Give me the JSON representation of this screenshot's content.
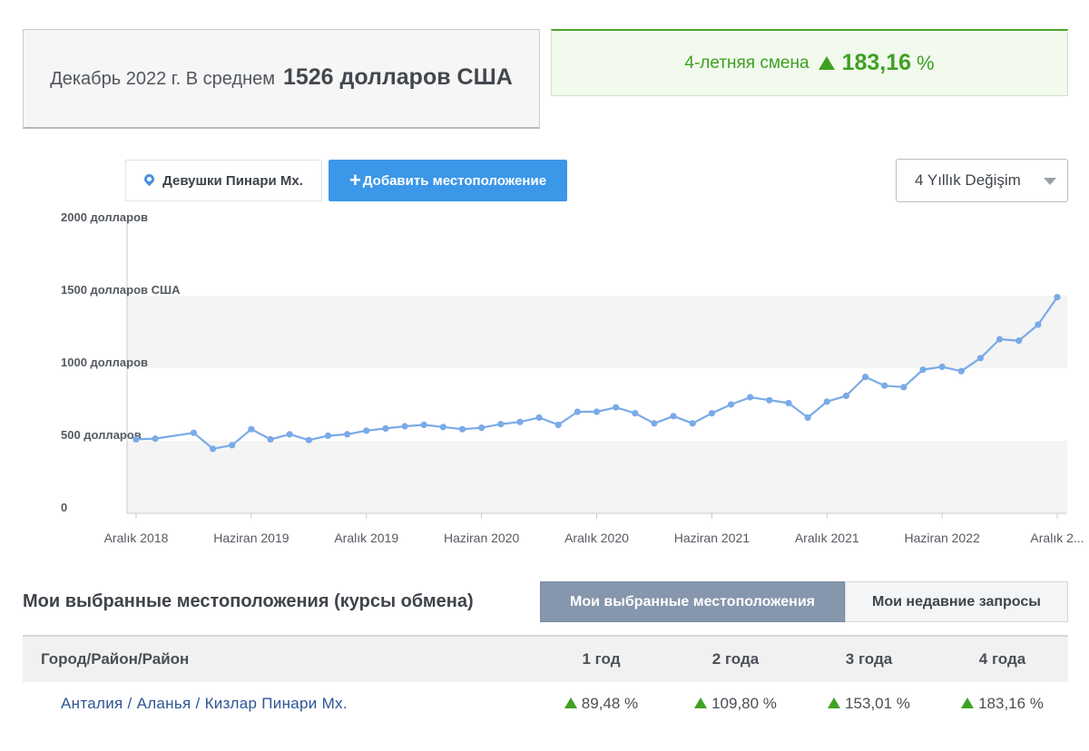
{
  "summary": {
    "avg_prefix": "Декабрь 2022 г. В среднем",
    "avg_value": "1526 долларов США",
    "change_label": "4-летняя смена",
    "change_value": "183,16",
    "change_unit": "%"
  },
  "controls": {
    "location_chip": "Девушки Пинари Мх.",
    "add_location_button": "Добавить местоположение",
    "period_select": "4 Yıllık Değişim"
  },
  "chart_data": {
    "type": "line",
    "y_tick_labels": [
      "2000 долларов",
      "1500 долларов США",
      "1000 долларов",
      "500 долларов",
      "0"
    ],
    "y_ticks": [
      2000,
      1500,
      1000,
      500,
      0
    ],
    "x_tick_labels": [
      "Aralık 2018",
      "Haziran 2019",
      "Aralık 2019",
      "Haziran 2020",
      "Aralık 2020",
      "Haziran 2021",
      "Aralık 2021",
      "Haziran 2022",
      "Aralık 2..."
    ],
    "ylim": [
      0,
      2000
    ],
    "x_range_months": [
      0,
      48
    ],
    "series": [
      {
        "color": "#7aaae8",
        "x": [
          0,
          1,
          3,
          4,
          5,
          6,
          7,
          8,
          9,
          10,
          11,
          12,
          13,
          14,
          15,
          16,
          17,
          18,
          19,
          20,
          21,
          22,
          23,
          24,
          25,
          26,
          27,
          28,
          29,
          30,
          31,
          32,
          33,
          34,
          35,
          36,
          37,
          38,
          39,
          40,
          41,
          42,
          43,
          44,
          45,
          46,
          47,
          48
        ],
        "values": [
          510,
          515,
          555,
          445,
          470,
          580,
          510,
          545,
          505,
          535,
          545,
          570,
          585,
          600,
          610,
          595,
          580,
          590,
          615,
          630,
          660,
          610,
          700,
          700,
          730,
          690,
          620,
          670,
          620,
          690,
          750,
          800,
          780,
          760,
          660,
          770,
          810,
          940,
          880,
          870,
          990,
          1010,
          980,
          1070,
          1200,
          1190,
          1300,
          1490
        ]
      }
    ]
  },
  "selected": {
    "title": "Мои выбранные местоположения (курсы обмена)",
    "tab_selected": "Мои выбранные местоположения",
    "tab_recent": "Мои недавние запросы",
    "columns": [
      "Город/Район/Район",
      "1 год",
      "2 года",
      "3 года",
      "4 года"
    ],
    "rows": [
      {
        "city": "Анталия / Аланья / Кизлар Пинари Мх.",
        "y1": "89,48 %",
        "y2": "109,80 %",
        "y3": "153,01 %",
        "y4": "183,16 %"
      }
    ]
  }
}
